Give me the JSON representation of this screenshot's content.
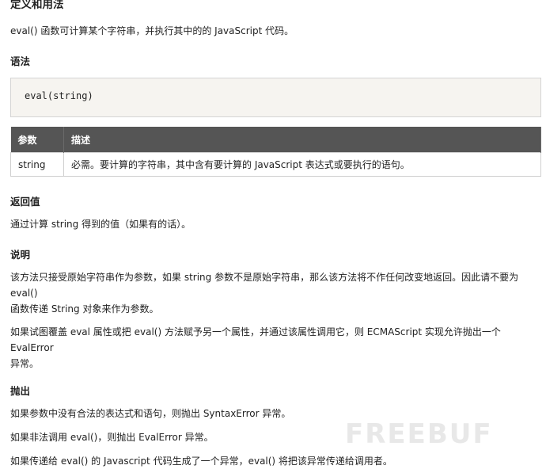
{
  "definition": {
    "heading": "定义和用法",
    "text": "eval() 函数可计算某个字符串，并执行其中的的 JavaScript 代码。"
  },
  "syntax": {
    "heading": "语法",
    "code": "eval(string)"
  },
  "params": {
    "headers": [
      "参数",
      "描述"
    ],
    "rows": [
      [
        "string",
        "必需。要计算的字符串，其中含有要计算的 JavaScript 表达式或要执行的语句。"
      ]
    ]
  },
  "return_value": {
    "heading": "返回值",
    "text": "通过计算 string 得到的值（如果有的话）。"
  },
  "description": {
    "heading": "说明",
    "para1_line1": "该方法只接受原始字符串作为参数，如果 string 参数不是原始字符串，那么该方法将不作任何改变地返回。因此请不要为 eval()",
    "para1_line2": "函数传递 String 对象来作为参数。",
    "para2_line1": "如果试图覆盖 eval 属性或把 eval() 方法赋予另一个属性，并通过该属性调用它，则 ECMAScript 实现允许抛出一个 EvalError",
    "para2_line2": "异常。"
  },
  "throws": {
    "heading": "抛出",
    "line1": "如果参数中没有合法的表达式和语句，则抛出 SyntaxError 异常。",
    "line2": "如果非法调用 eval()，则抛出 EvalError 异常。",
    "line3": "如果传递给 eval() 的 Javascript 代码生成了一个异常，eval() 将把该异常传递给调用者。"
  },
  "watermark": "FREEBUF"
}
